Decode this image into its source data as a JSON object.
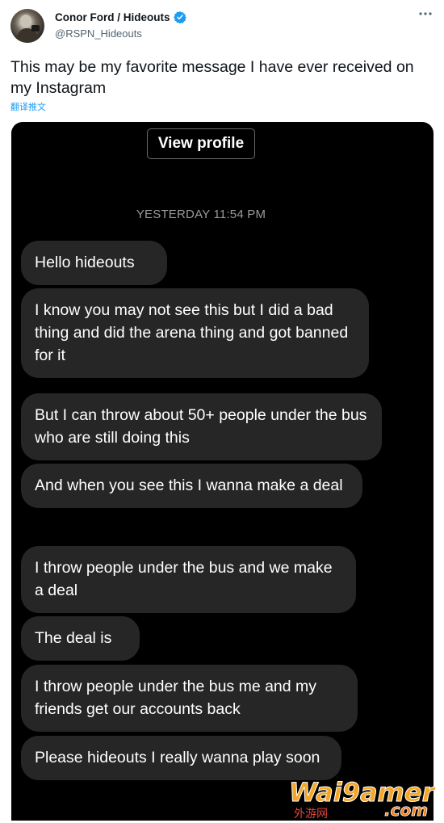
{
  "tweet": {
    "display_name": "Conor Ford / Hideouts",
    "handle": "@RSPN_Hideouts",
    "more_icon": "more-horizontal-icon",
    "verified_icon": "verified-badge-icon",
    "text": "This may be my favorite message I have ever received on my Instagram",
    "translate_label": "翻译推文",
    "link_color": "#1d9bf0"
  },
  "dm": {
    "view_profile_label": "View profile",
    "timestamp": "YESTERDAY 11:54 PM",
    "bubble_color": "#262626",
    "messages": [
      "Hello hideouts",
      "I know you may not see this but I did a bad thing and did the arena thing and got banned for it",
      "But I can throw about 50+ people under the bus who are still doing this",
      "And when you see this I wanna make a deal",
      "I throw people under the bus and we make a deal",
      "The deal is",
      "I throw people under the bus me and my friends get our accounts back",
      "Please hideouts I really wanna play soon"
    ]
  },
  "watermark": {
    "brand": "Wai9amer",
    "suffix": ".com",
    "sub": "外游网"
  }
}
